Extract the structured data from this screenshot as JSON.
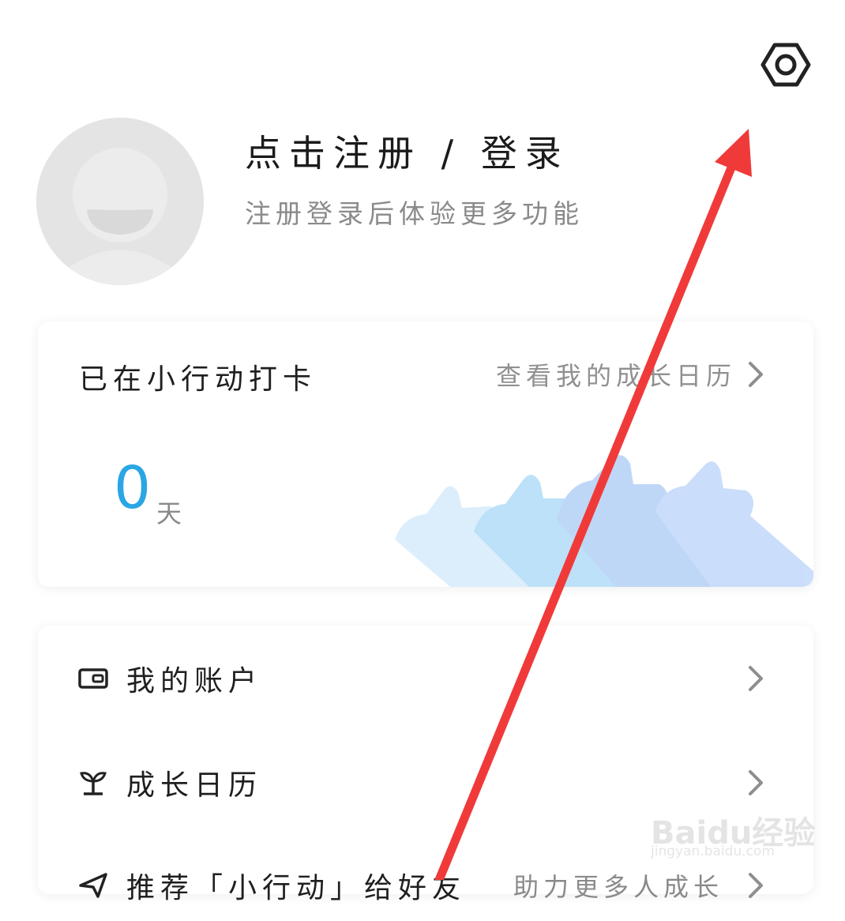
{
  "header": {
    "settings_icon": "gear-hexagon-icon"
  },
  "profile": {
    "login_title": "点击注册 / 登录",
    "login_subtitle": "注册登录后体验更多功能"
  },
  "checkin_card": {
    "title": "已在小行动打卡",
    "calendar_link": "查看我的成长日历",
    "days": "0",
    "days_unit": "天"
  },
  "menu": {
    "items": [
      {
        "label": "我的账户",
        "icon": "wallet-icon"
      },
      {
        "label": "成长日历",
        "icon": "sprout-icon"
      },
      {
        "label": "推荐「小行动」给好友",
        "extra": "助力更多人成长",
        "icon": "send-icon"
      }
    ]
  },
  "watermark": {
    "brand": "Baidu经验",
    "url": "jingyan.baidu.com"
  },
  "colors": {
    "accent_blue": "#2ba6e4",
    "annotation_red": "#f03a3a"
  }
}
